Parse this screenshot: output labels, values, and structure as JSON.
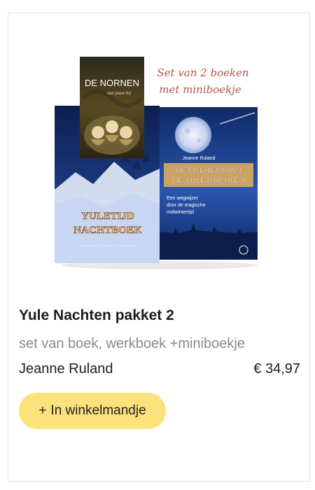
{
  "product": {
    "title": "Yule Nachten pakket 2",
    "subtitle": "set van boek, werkboek +miniboekje",
    "author": "Jeanne Ruland",
    "price": "€ 34,97"
  },
  "image": {
    "banner": [
      "Set van 2 boeken",
      "met miniboekje"
    ],
    "book_back_title": [
      "DE NORNEN"
    ],
    "book_back_sub": "van jouw lot",
    "book_left_title": [
      "YULETIJD",
      "NACHTBOEK"
    ],
    "book_left_sub": "een boek om je nachten te beschrijven",
    "book_right_author": "Jeanne Ruland",
    "book_right_title": [
      "HET GEHEIM VAN",
      "DE YULE NACHTEN"
    ],
    "book_right_sub": [
      "Een wegwijzer",
      "door de magische",
      "midwintertijd"
    ]
  },
  "cart_button": {
    "plus": "+",
    "label": "In winkelmandje"
  },
  "colors": {
    "button_bg": "#fbe27a",
    "banner_text": "#b5534d",
    "book_blue": "#1f3b7c"
  }
}
